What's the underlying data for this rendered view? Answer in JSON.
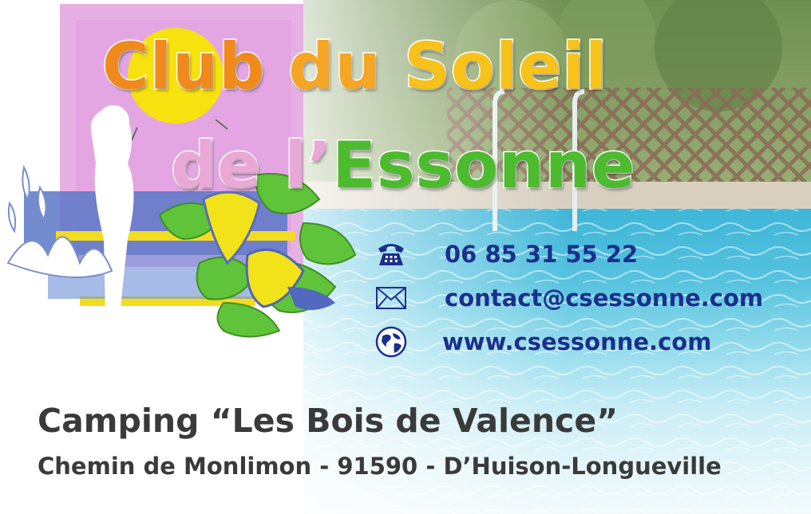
{
  "card": {
    "title": {
      "line1": [
        {
          "text": "Club ",
          "color": "#f08a1c"
        },
        {
          "text": "du ",
          "color": "#f5a623"
        },
        {
          "text": "Soleil",
          "color": "#f7c21a"
        }
      ],
      "line2": [
        {
          "text": "de l’",
          "color": "#e9a8d6"
        },
        {
          "text": "Essonne",
          "color": "#4cbb2e"
        }
      ]
    },
    "contact": {
      "phone": {
        "icon": "telephone-icon",
        "text": "06 85 31 55 22"
      },
      "email": {
        "icon": "envelope-icon",
        "text": "contact@csessonne.com"
      },
      "web": {
        "icon": "globe-icon",
        "text": "www.csessonne.com"
      }
    },
    "venue": "Camping “Les Bois de Valence”",
    "address": "Chemin de Monlimon - 91590 - D’Huison-Longueville",
    "colors": {
      "contact_text": "#1b2f8c",
      "address_text": "#3a3a3a",
      "pool_water": "#3fb6d8"
    }
  }
}
